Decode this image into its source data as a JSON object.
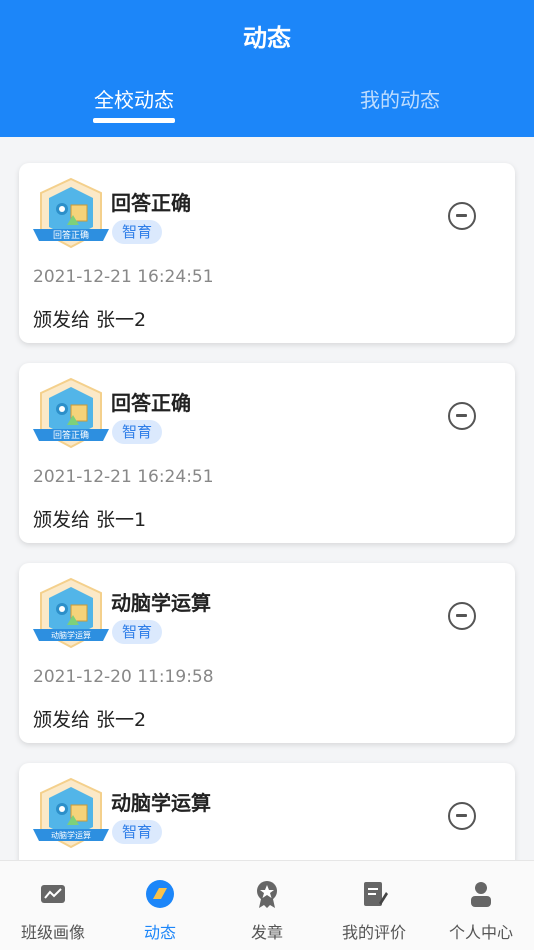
{
  "header": {
    "title": "动态",
    "tabs": [
      {
        "label": "全校动态"
      },
      {
        "label": "我的动态"
      }
    ]
  },
  "feed": [
    {
      "title": "回答正确",
      "badge_text": "回答正确",
      "tag": "智育",
      "time": "2021-12-21 16:24:51",
      "desc": "颁发给 张一2"
    },
    {
      "title": "回答正确",
      "badge_text": "回答正确",
      "tag": "智育",
      "time": "2021-12-21 16:24:51",
      "desc": "颁发给 张一1"
    },
    {
      "title": "动脑学运算",
      "badge_text": "动脑学运算",
      "tag": "智育",
      "time": "2021-12-20 11:19:58",
      "desc": "颁发给 张一2"
    },
    {
      "title": "动脑学运算",
      "badge_text": "动脑学运算",
      "tag": "智育",
      "time": "",
      "desc": ""
    }
  ],
  "tabbar": {
    "items": [
      {
        "label": "班级画像",
        "icon": "class-portrait-icon"
      },
      {
        "label": "动态",
        "icon": "feed-icon"
      },
      {
        "label": "发章",
        "icon": "medal-icon"
      },
      {
        "label": "我的评价",
        "icon": "evaluation-icon"
      },
      {
        "label": "个人中心",
        "icon": "user-icon"
      }
    ],
    "active_color": "#1c86f9",
    "inactive_color": "#555555"
  },
  "colors": {
    "brand": "#1c86f9",
    "tag_bg": "#dbe9fd",
    "tag_text": "#2f7ee8"
  }
}
